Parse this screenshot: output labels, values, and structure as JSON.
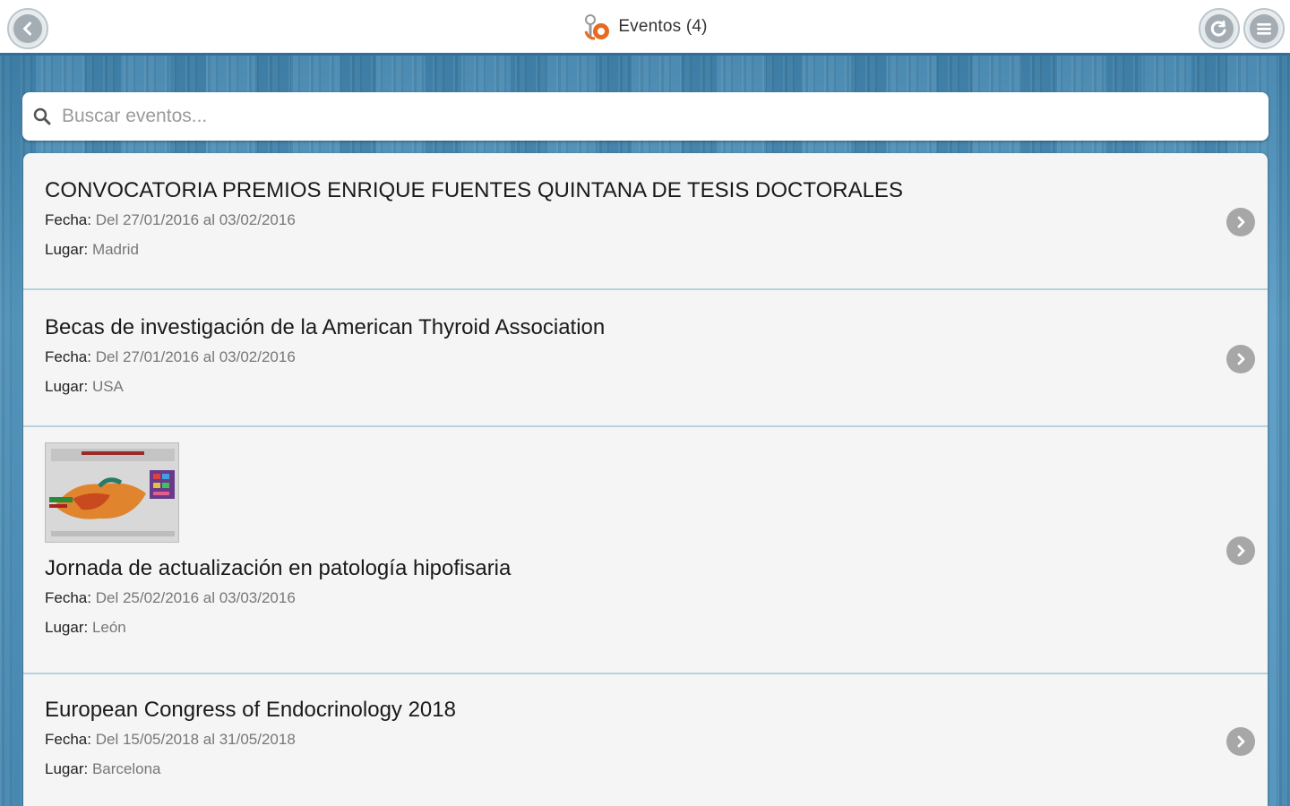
{
  "header": {
    "title": "Eventos (4)",
    "back_icon": "chevron-left-icon",
    "refresh_icon": "refresh-icon",
    "menu_icon": "menu-icon",
    "accent": "#2f6f9a"
  },
  "search": {
    "placeholder": "Buscar eventos...",
    "value": ""
  },
  "labels": {
    "date": "Fecha:",
    "place": "Lugar:"
  },
  "events": [
    {
      "title": "CONVOCATORIA PREMIOS ENRIQUE FUENTES QUINTANA DE TESIS DOCTORALES",
      "date": "Del 27/01/2016 al 03/02/2016",
      "place": "Madrid"
    },
    {
      "title": "Becas de investigación de la American Thyroid Association",
      "date": "Del 27/01/2016 al 03/02/2016",
      "place": "USA"
    },
    {
      "title": "Jornada de actualización en patología hipofisaria",
      "date": "Del 25/02/2016 al 03/03/2016",
      "place": "León",
      "has_image": true
    },
    {
      "title": "European Congress of Endocrinology 2018",
      "date": "Del 15/05/2018 al 31/05/2018",
      "place": "Barcelona"
    }
  ]
}
